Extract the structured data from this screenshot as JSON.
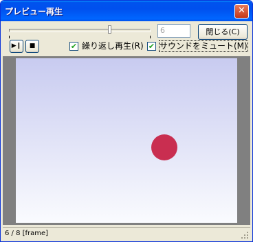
{
  "window": {
    "title": "プレビュー再生",
    "close_glyph": "✕"
  },
  "controls": {
    "slider": {
      "value": 6,
      "min": 1,
      "max": 8
    },
    "frame_field": {
      "value": "6"
    },
    "close_button": {
      "label": "閉じる(C)"
    },
    "play_button": {
      "icon": "play-pause-icon",
      "glyph": "▶❙"
    },
    "stop_button": {
      "icon": "stop-icon",
      "glyph": "■"
    },
    "repeat_checkbox": {
      "label": "繰り返し再生(R)",
      "checked": true,
      "mark": "✔"
    },
    "mute_checkbox": {
      "label": "サウンドをミュート(M)",
      "checked": true,
      "mark": "✔"
    }
  },
  "preview": {
    "background_top": "#c8cbf0",
    "background_bottom": "#fafbfe",
    "ball_color": "#c92e50"
  },
  "status": {
    "text": "6 / 8 [frame]"
  }
}
